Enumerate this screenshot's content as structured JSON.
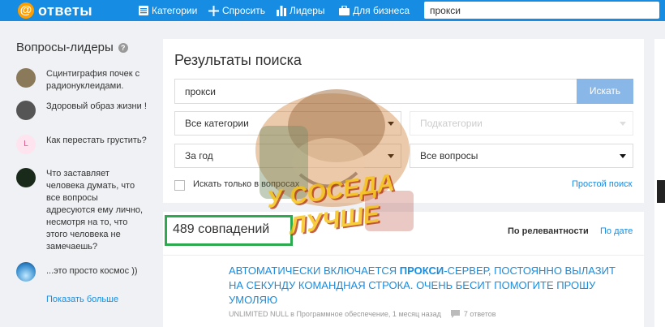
{
  "header": {
    "logo_text": "ответы",
    "nav": [
      {
        "label": "Категории",
        "icon": "list-icon"
      },
      {
        "label": "Спросить",
        "icon": "plus-icon"
      },
      {
        "label": "Лидеры",
        "icon": "bar-chart-icon"
      },
      {
        "label": "Для бизнеса",
        "icon": "briefcase-icon"
      }
    ],
    "search_value": "прокси"
  },
  "sidebar": {
    "title": "Вопросы-лидеры",
    "items": [
      {
        "text": "Сцинтиграфия почек с радионуклеидами."
      },
      {
        "text": "Здоровый образ жизни !"
      },
      {
        "text": "Как перестать грустить?",
        "avatar_letter": "L"
      },
      {
        "text": "Что заставляет человека думать, что все вопросы адресуются ему лично, несмотря на то, что этого человека не замечаешь?"
      },
      {
        "text": "...это просто космос ))"
      }
    ],
    "show_more": "Показать больше"
  },
  "search": {
    "title": "Результаты поиска",
    "query": "прокси",
    "button": "Искать",
    "category": "Все категории",
    "subcategory": "Подкатегории",
    "period": "За год",
    "question_filter": "Все вопросы",
    "only_questions_label": "Искать только в вопросах",
    "simple_search": "Простой поиск"
  },
  "results": {
    "count": "489 совпадений",
    "sort_relevance": "По релевантности",
    "sort_date": "По дате",
    "item": {
      "title_before": "АВТОМАТИЧЕСКИ ВКЛЮЧАЕТСЯ ",
      "title_highlight": "ПРОКСИ",
      "title_after": "-СЕРВЕР, ПОСТОЯННО ВЫЛАЗИТ НА СЕКУНДУ КОМАНДНАЯ СТРОКА. ОЧЕНЬ БЕСИТ ПОМОГИТЕ ПРОШУ УМОЛЯЮ",
      "meta": "UNLIMITED NULL в Программное обеспечение, 1 месяц назад",
      "answers": "7 ответов"
    }
  },
  "sticker": {
    "text": "У СОСЕДА ЛУЧШЕ"
  },
  "colors": {
    "brand_blue": "#168de2",
    "logo_orange": "#ff9e00",
    "highlight_green": "#2da94f",
    "button_blue": "#89b8e8"
  }
}
